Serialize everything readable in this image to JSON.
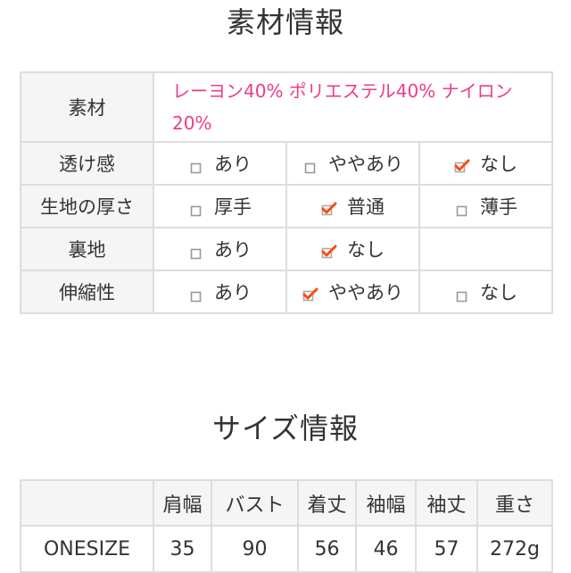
{
  "material_section": {
    "title": "素材情報",
    "material_label": "素材",
    "material_value": "レーヨン40% ポリエステル40% ナイロン20%",
    "rows": [
      {
        "label": "透け感",
        "options": [
          {
            "label": "あり",
            "checked": false
          },
          {
            "label": "ややあり",
            "checked": false
          },
          {
            "label": "なし",
            "checked": true
          }
        ]
      },
      {
        "label": "生地の厚さ",
        "options": [
          {
            "label": "厚手",
            "checked": false
          },
          {
            "label": "普通",
            "checked": true
          },
          {
            "label": "薄手",
            "checked": false
          }
        ]
      },
      {
        "label": "裏地",
        "options": [
          {
            "label": "あり",
            "checked": false
          },
          {
            "label": "なし",
            "checked": true
          }
        ]
      },
      {
        "label": "伸縮性",
        "options": [
          {
            "label": "あり",
            "checked": false
          },
          {
            "label": "ややあり",
            "checked": true
          },
          {
            "label": "なし",
            "checked": false
          }
        ]
      }
    ],
    "colors": {
      "accent_text": "#ee3b8c",
      "check_mark": "#ff4a0a",
      "border": "#dddddd",
      "header_bg": "#f5f5f5"
    }
  },
  "size_section": {
    "title": "サイズ情報",
    "columns": [
      "",
      "肩幅",
      "バスト",
      "着丈",
      "袖幅",
      "袖丈",
      "重さ"
    ],
    "rows": [
      {
        "size": "ONESIZE",
        "values": [
          "35",
          "90",
          "56",
          "46",
          "57",
          "272g"
        ]
      }
    ]
  }
}
